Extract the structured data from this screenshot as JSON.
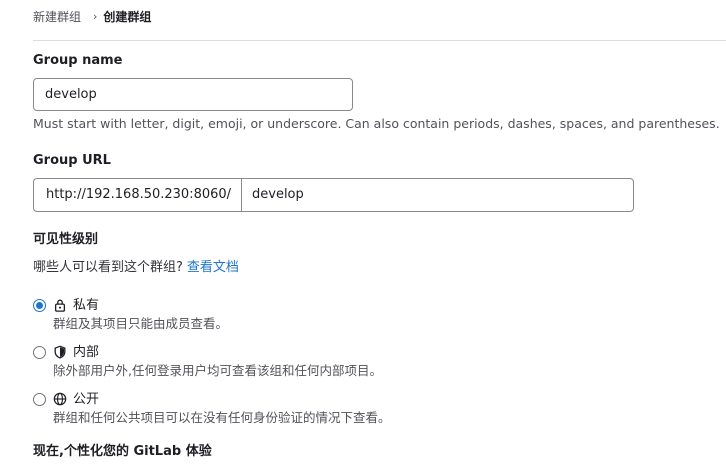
{
  "breadcrumb": {
    "parent": "新建群组",
    "separator": "›",
    "current": "创建群组"
  },
  "group_name": {
    "label": "Group name",
    "value": "develop",
    "help": "Must start with letter, digit, emoji, or underscore. Can also contain periods, dashes, spaces, and parentheses."
  },
  "group_url": {
    "label": "Group URL",
    "prefix": "http://192.168.50.230:8060/",
    "value": "develop"
  },
  "visibility": {
    "heading": "可见性级别",
    "question": "哪些人可以看到这个群组?",
    "doc_link": "查看文档",
    "options": [
      {
        "title": "私有",
        "description": "群组及其项目只能由成员查看。",
        "icon": "lock-icon",
        "checked": true
      },
      {
        "title": "内部",
        "description": "除外部用户外,任何登录用户均可查看该组和任何内部项目。",
        "icon": "shield-icon",
        "checked": false
      },
      {
        "title": "公开",
        "description": "群组和任何公共项目可以在没有任何身份验证的情况下查看。",
        "icon": "globe-icon",
        "checked": false
      }
    ]
  },
  "personalize": {
    "heading": "现在,个性化您的 GitLab 体验"
  },
  "colors": {
    "link": "#1f75cb",
    "radio_checked": "#1f75cb",
    "border": "#89888d",
    "text": "#1f1e24",
    "muted": "#535158"
  }
}
